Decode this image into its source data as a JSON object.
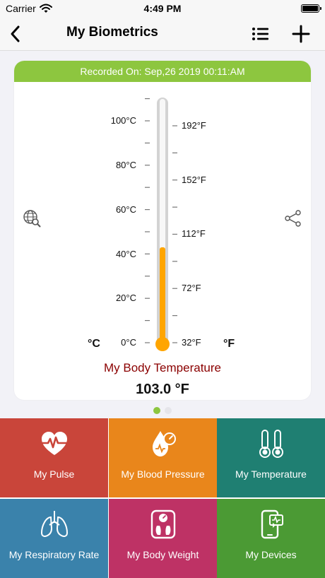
{
  "status_bar": {
    "carrier": "Carrier",
    "time": "4:49 PM"
  },
  "nav": {
    "title": "My Biometrics",
    "back_icon": "chevron-left-icon",
    "list_icon": "list-icon",
    "add_icon": "plus-icon"
  },
  "card": {
    "header": "Recorded On: Sep,26 2019 00:11:AM",
    "celsius_ticks": [
      "100°C",
      "80°C",
      "60°C",
      "40°C",
      "20°C",
      "0°C"
    ],
    "fahrenheit_ticks": [
      "192°F",
      "152°F",
      "112°F",
      "72°F",
      "32°F"
    ],
    "celsius_unit": "°C",
    "fahrenheit_unit": "°F",
    "level_celsius": 43,
    "scale_max_celsius": 100,
    "measurement_title": "My Body Temperature",
    "measurement_value": "103.0 °F"
  },
  "pager": {
    "pages": 2,
    "active": 0
  },
  "tiles": [
    {
      "label": "My Pulse",
      "icon": "heart-pulse-icon",
      "color": "#c9453a"
    },
    {
      "label": "My Blood Pressure",
      "icon": "blood-drop-gauge-icon",
      "color": "#e9861b"
    },
    {
      "label": "My Temperature",
      "icon": "thermometers-icon",
      "color": "#1f7f72"
    },
    {
      "label": "My Respiratory Rate",
      "icon": "lungs-icon",
      "color": "#3a82ab"
    },
    {
      "label": "My Body Weight",
      "icon": "weight-scale-icon",
      "color": "#be3265"
    },
    {
      "label": "My Devices",
      "icon": "phone-device-icon",
      "color": "#4b9a34"
    }
  ],
  "colors": {
    "accent_green": "#8dc63f",
    "mercury": "#ffa500",
    "title_red": "#8b0000"
  }
}
